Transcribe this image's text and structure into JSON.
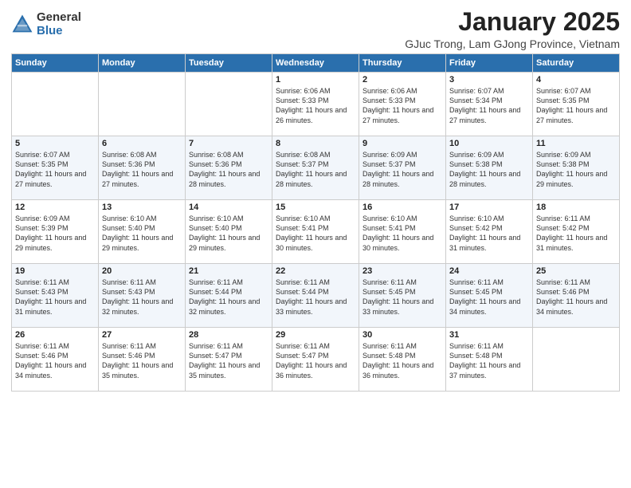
{
  "logo": {
    "general": "General",
    "blue": "Blue"
  },
  "title": "January 2025",
  "location": "GJuc Trong, Lam GJong Province, Vietnam",
  "days_of_week": [
    "Sunday",
    "Monday",
    "Tuesday",
    "Wednesday",
    "Thursday",
    "Friday",
    "Saturday"
  ],
  "weeks": [
    [
      {
        "day": "",
        "content": ""
      },
      {
        "day": "",
        "content": ""
      },
      {
        "day": "",
        "content": ""
      },
      {
        "day": "1",
        "content": "Sunrise: 6:06 AM\nSunset: 5:33 PM\nDaylight: 11 hours\nand 26 minutes."
      },
      {
        "day": "2",
        "content": "Sunrise: 6:06 AM\nSunset: 5:33 PM\nDaylight: 11 hours\nand 27 minutes."
      },
      {
        "day": "3",
        "content": "Sunrise: 6:07 AM\nSunset: 5:34 PM\nDaylight: 11 hours\nand 27 minutes."
      },
      {
        "day": "4",
        "content": "Sunrise: 6:07 AM\nSunset: 5:35 PM\nDaylight: 11 hours\nand 27 minutes."
      }
    ],
    [
      {
        "day": "5",
        "content": "Sunrise: 6:07 AM\nSunset: 5:35 PM\nDaylight: 11 hours\nand 27 minutes."
      },
      {
        "day": "6",
        "content": "Sunrise: 6:08 AM\nSunset: 5:36 PM\nDaylight: 11 hours\nand 27 minutes."
      },
      {
        "day": "7",
        "content": "Sunrise: 6:08 AM\nSunset: 5:36 PM\nDaylight: 11 hours\nand 28 minutes."
      },
      {
        "day": "8",
        "content": "Sunrise: 6:08 AM\nSunset: 5:37 PM\nDaylight: 11 hours\nand 28 minutes."
      },
      {
        "day": "9",
        "content": "Sunrise: 6:09 AM\nSunset: 5:37 PM\nDaylight: 11 hours\nand 28 minutes."
      },
      {
        "day": "10",
        "content": "Sunrise: 6:09 AM\nSunset: 5:38 PM\nDaylight: 11 hours\nand 28 minutes."
      },
      {
        "day": "11",
        "content": "Sunrise: 6:09 AM\nSunset: 5:38 PM\nDaylight: 11 hours\nand 29 minutes."
      }
    ],
    [
      {
        "day": "12",
        "content": "Sunrise: 6:09 AM\nSunset: 5:39 PM\nDaylight: 11 hours\nand 29 minutes."
      },
      {
        "day": "13",
        "content": "Sunrise: 6:10 AM\nSunset: 5:40 PM\nDaylight: 11 hours\nand 29 minutes."
      },
      {
        "day": "14",
        "content": "Sunrise: 6:10 AM\nSunset: 5:40 PM\nDaylight: 11 hours\nand 29 minutes."
      },
      {
        "day": "15",
        "content": "Sunrise: 6:10 AM\nSunset: 5:41 PM\nDaylight: 11 hours\nand 30 minutes."
      },
      {
        "day": "16",
        "content": "Sunrise: 6:10 AM\nSunset: 5:41 PM\nDaylight: 11 hours\nand 30 minutes."
      },
      {
        "day": "17",
        "content": "Sunrise: 6:10 AM\nSunset: 5:42 PM\nDaylight: 11 hours\nand 31 minutes."
      },
      {
        "day": "18",
        "content": "Sunrise: 6:11 AM\nSunset: 5:42 PM\nDaylight: 11 hours\nand 31 minutes."
      }
    ],
    [
      {
        "day": "19",
        "content": "Sunrise: 6:11 AM\nSunset: 5:43 PM\nDaylight: 11 hours\nand 31 minutes."
      },
      {
        "day": "20",
        "content": "Sunrise: 6:11 AM\nSunset: 5:43 PM\nDaylight: 11 hours\nand 32 minutes."
      },
      {
        "day": "21",
        "content": "Sunrise: 6:11 AM\nSunset: 5:44 PM\nDaylight: 11 hours\nand 32 minutes."
      },
      {
        "day": "22",
        "content": "Sunrise: 6:11 AM\nSunset: 5:44 PM\nDaylight: 11 hours\nand 33 minutes."
      },
      {
        "day": "23",
        "content": "Sunrise: 6:11 AM\nSunset: 5:45 PM\nDaylight: 11 hours\nand 33 minutes."
      },
      {
        "day": "24",
        "content": "Sunrise: 6:11 AM\nSunset: 5:45 PM\nDaylight: 11 hours\nand 34 minutes."
      },
      {
        "day": "25",
        "content": "Sunrise: 6:11 AM\nSunset: 5:46 PM\nDaylight: 11 hours\nand 34 minutes."
      }
    ],
    [
      {
        "day": "26",
        "content": "Sunrise: 6:11 AM\nSunset: 5:46 PM\nDaylight: 11 hours\nand 34 minutes."
      },
      {
        "day": "27",
        "content": "Sunrise: 6:11 AM\nSunset: 5:46 PM\nDaylight: 11 hours\nand 35 minutes."
      },
      {
        "day": "28",
        "content": "Sunrise: 6:11 AM\nSunset: 5:47 PM\nDaylight: 11 hours\nand 35 minutes."
      },
      {
        "day": "29",
        "content": "Sunrise: 6:11 AM\nSunset: 5:47 PM\nDaylight: 11 hours\nand 36 minutes."
      },
      {
        "day": "30",
        "content": "Sunrise: 6:11 AM\nSunset: 5:48 PM\nDaylight: 11 hours\nand 36 minutes."
      },
      {
        "day": "31",
        "content": "Sunrise: 6:11 AM\nSunset: 5:48 PM\nDaylight: 11 hours\nand 37 minutes."
      },
      {
        "day": "",
        "content": ""
      }
    ]
  ]
}
